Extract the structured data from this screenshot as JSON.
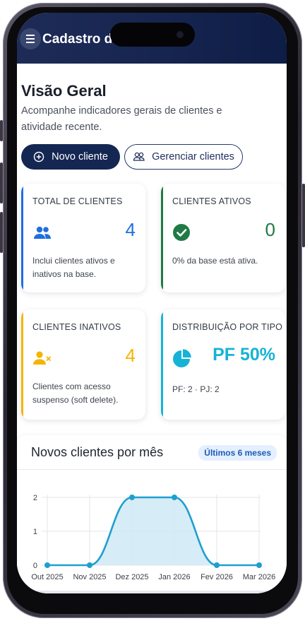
{
  "app": {
    "title": "Cadastro de"
  },
  "page": {
    "heading": "Visão Geral",
    "subtitle": "Acompanhe indicadores gerais de clientes e atividade recente."
  },
  "actions": {
    "new_client": "Novo cliente",
    "manage_clients": "Gerenciar clientes"
  },
  "cards": [
    {
      "label": "TOTAL DE CLIENTES",
      "value": "4",
      "desc": "Inclui clientes ativos e inativos na base.",
      "accent": "#1f6fe0",
      "icon": "users-icon"
    },
    {
      "label": "CLIENTES ATIVOS",
      "value": "0",
      "desc": "0% da base está ativa.",
      "accent": "#1f7a44",
      "icon": "check-circle-icon"
    },
    {
      "label": "CLIENTES INATIVOS",
      "value": "4",
      "desc": "Clientes com acesso suspenso (soft delete).",
      "accent": "#f5b400",
      "icon": "user-x-icon"
    },
    {
      "label": "DISTRIBUIÇÃO POR TIPO",
      "value": "PF 50%",
      "desc": "PF: 2 · PJ: 2",
      "accent": "#16b3d6",
      "icon": "pie-chart-icon"
    }
  ],
  "chart_section": {
    "title": "Novos clientes por mês",
    "badge": "Últimos 6 meses"
  },
  "chart_data": {
    "type": "area",
    "categories": [
      "Out 2025",
      "Nov 2025",
      "Dez 2025",
      "Jan 2026",
      "Fev 2026",
      "Mar 2026"
    ],
    "values": [
      0,
      0,
      2,
      2,
      0,
      0
    ],
    "yticks": [
      "0",
      "1",
      "2"
    ],
    "ylim": [
      0,
      2
    ],
    "grid": true,
    "color": "#1e9fd0"
  }
}
